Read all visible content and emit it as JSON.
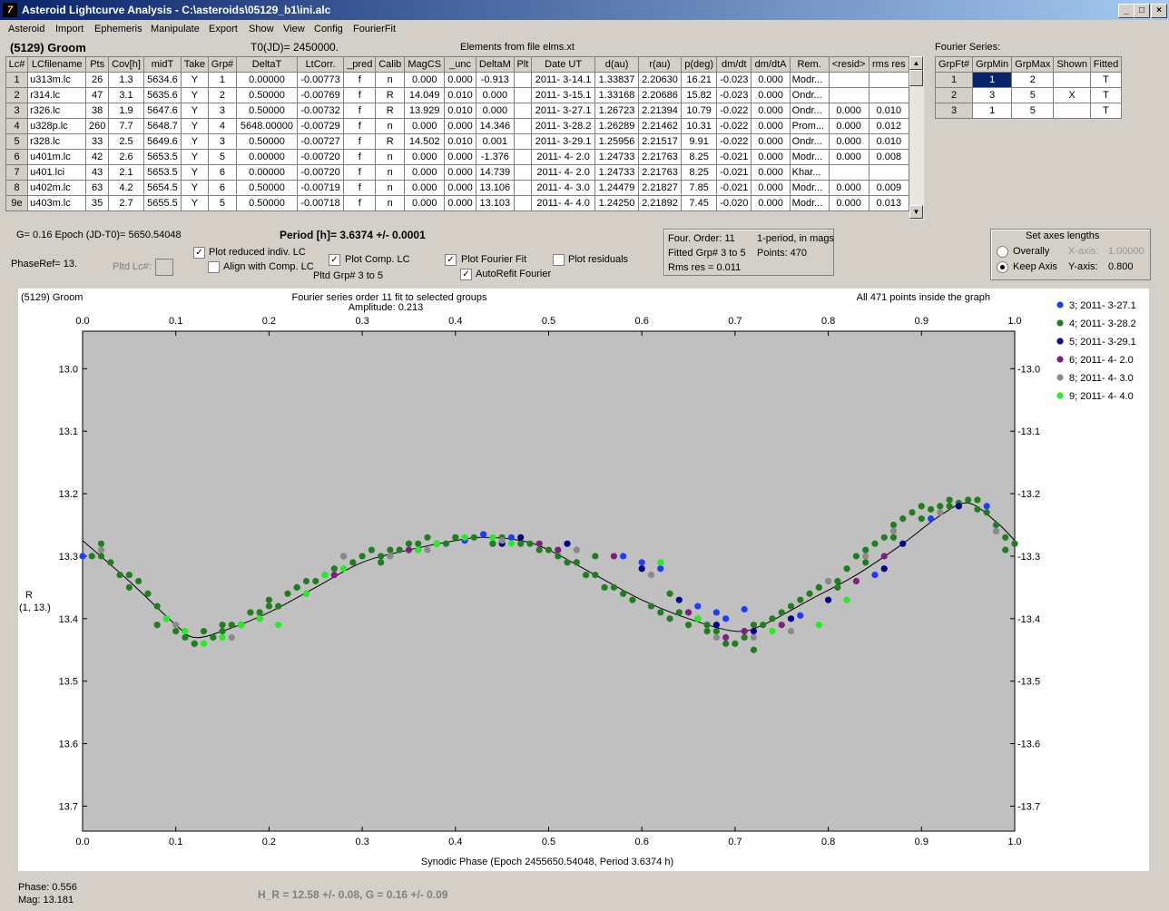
{
  "window": {
    "title": "Asteroid Lightcurve Analysis - C:\\asteroids\\05129_b1\\ini.alc",
    "min": "_",
    "max": "□",
    "close": "×"
  },
  "menu": [
    "Asteroid",
    "Import",
    "Ephemeris",
    "Manipulate",
    "Export",
    "Show",
    "View",
    "Config",
    "FourierFit"
  ],
  "header": {
    "object": "(5129) Groom",
    "t0": "T0(JD)= 2450000.",
    "elements": "Elements from file elms.xt",
    "fourier_series": "Fourier Series:"
  },
  "lc_table": {
    "columns": [
      "Lc#",
      "LCfilename",
      "Pts",
      "Cov[h]",
      "midT",
      "Take",
      "Grp#",
      "DeltaT",
      "LtCorr.",
      "_pred",
      "Calib",
      "MagCS",
      "_unc",
      "DeltaM",
      "Plt",
      "Date UT",
      "d(au)",
      "r(au)",
      "p(deg)",
      "dm/dt",
      "dm/dtA",
      "Rem.",
      "<resid>",
      "rms res"
    ],
    "rows": [
      [
        "1",
        "u313m.lc",
        "26",
        "1.3",
        "5634.6",
        "Y",
        "1",
        "0.00000",
        "-0.00773",
        "f",
        "n",
        "0.000",
        "0.000",
        "-0.913",
        "",
        "2011- 3-14.1",
        "1.33837",
        "2.20630",
        "16.21",
        "-0.023",
        "0.000",
        "Modr...",
        "",
        ""
      ],
      [
        "2",
        "r314.lc",
        "47",
        "3.1",
        "5635.6",
        "Y",
        "2",
        "0.50000",
        "-0.00769",
        "f",
        "R",
        "14.049",
        "0.010",
        "0.000",
        "",
        "2011- 3-15.1",
        "1.33168",
        "2.20686",
        "15.82",
        "-0.023",
        "0.000",
        "Ondr...",
        "",
        ""
      ],
      [
        "3",
        "r326.lc",
        "38",
        "1.9",
        "5647.6",
        "Y",
        "3",
        "0.50000",
        "-0.00732",
        "f",
        "R",
        "13.929",
        "0.010",
        "0.000",
        "",
        "2011- 3-27.1",
        "1.26723",
        "2.21394",
        "10.79",
        "-0.022",
        "0.000",
        "Ondr...",
        "0.000",
        "0.010"
      ],
      [
        "4",
        "u328p.lc",
        "260",
        "7.7",
        "5648.7",
        "Y",
        "4",
        "5648.00000",
        "-0.00729",
        "f",
        "n",
        "0.000",
        "0.000",
        "14.346",
        "",
        "2011- 3-28.2",
        "1.26289",
        "2.21462",
        "10.31",
        "-0.022",
        "0.000",
        "Prom...",
        "0.000",
        "0.012"
      ],
      [
        "5",
        "r328.lc",
        "33",
        "2.5",
        "5649.6",
        "Y",
        "3",
        "0.50000",
        "-0.00727",
        "f",
        "R",
        "14.502",
        "0.010",
        "0.001",
        "",
        "2011- 3-29.1",
        "1.25956",
        "2.21517",
        "9.91",
        "-0.022",
        "0.000",
        "Ondr...",
        "0.000",
        "0.010"
      ],
      [
        "6",
        "u401m.lc",
        "42",
        "2.6",
        "5653.5",
        "Y",
        "5",
        "0.00000",
        "-0.00720",
        "f",
        "n",
        "0.000",
        "0.000",
        "-1.376",
        "",
        "2011- 4- 2.0",
        "1.24733",
        "2.21763",
        "8.25",
        "-0.021",
        "0.000",
        "Modr...",
        "0.000",
        "0.008"
      ],
      [
        "7",
        "u401.lci",
        "43",
        "2.1",
        "5653.5",
        "Y",
        "6",
        "0.00000",
        "-0.00720",
        "f",
        "n",
        "0.000",
        "0.000",
        "14.739",
        "",
        "2011- 4- 2.0",
        "1.24733",
        "2.21763",
        "8.25",
        "-0.021",
        "0.000",
        "Khar...",
        "",
        ""
      ],
      [
        "8",
        "u402m.lc",
        "63",
        "4.2",
        "5654.5",
        "Y",
        "6",
        "0.50000",
        "-0.00719",
        "f",
        "n",
        "0.000",
        "0.000",
        "13.106",
        "",
        "2011- 4- 3.0",
        "1.24479",
        "2.21827",
        "7.85",
        "-0.021",
        "0.000",
        "Modr...",
        "0.000",
        "0.009"
      ],
      [
        "9e",
        "u403m.lc",
        "35",
        "2.7",
        "5655.5",
        "Y",
        "5",
        "0.50000",
        "-0.00718",
        "f",
        "n",
        "0.000",
        "0.000",
        "13.103",
        "",
        "2011- 4- 4.0",
        "1.24250",
        "2.21892",
        "7.45",
        "-0.020",
        "0.000",
        "Modr...",
        "0.000",
        "0.013"
      ]
    ]
  },
  "fourier_table": {
    "columns": [
      "GrpFt#",
      "GrpMin",
      "GrpMax",
      "Shown",
      "Fitted"
    ],
    "rows": [
      [
        "1",
        "1",
        "2",
        "",
        "T"
      ],
      [
        "2",
        "3",
        "5",
        "X",
        "T"
      ],
      [
        "3",
        "1",
        "5",
        "",
        "T"
      ]
    ]
  },
  "controls": {
    "g_epoch": "G= 0.16   Epoch (JD-T0)= 5650.54048",
    "period": "Period [h]= 3.6374 +/- 0.0001",
    "phase_ref": "PhaseRef= 13.",
    "pltd_lc": "Pltd Lc#:",
    "pltd_grp": "Pltd Grp#  3   to   5",
    "plot_reduced": "Plot reduced indiv. LC",
    "align_comp": "Align with Comp. LC",
    "plot_comp": "Plot Comp. LC",
    "plot_fourier": "Plot Fourier Fit",
    "autorefit": "AutoRefit Fourier",
    "plot_residuals": "Plot residuals",
    "four_order": "Four. Order: 11",
    "one_period": "1-period, in mags",
    "fitted_grp": "Fitted Grp# 3 to 5",
    "points": "Points: 470",
    "rms_res": "Rms res      = 0.011",
    "axes_title": "Set axes lengths",
    "overally": "Overally",
    "keep_axis": "Keep Axis",
    "x_axis_label": "X-axis:",
    "x_axis_value": "1.00000",
    "y_axis_label": "Y-axis:",
    "y_axis_value": "0.800"
  },
  "status": {
    "phase": "Phase:  0.556",
    "mag": "Mag:    13.181",
    "hg": "H_R = 12.58 +/- 0.08, G = 0.16 +/- 0.09"
  },
  "chart_data": {
    "type": "scatter",
    "title_left": "(5129) Groom",
    "title_center": "Fourier series order 11 fit to selected groups",
    "amplitude": "Amplitude: 0.213",
    "title_right": "All 471 points inside the graph",
    "xlabel": "Synodic Phase (Epoch 2455650.54048, Period 3.6374 h)",
    "ylabel": "R",
    "ylabel2": "(1, 13.)",
    "xlim": [
      0.0,
      1.0
    ],
    "ylim": [
      13.74,
      12.94
    ],
    "xticks": [
      "0.0",
      "0.1",
      "0.2",
      "0.3",
      "0.4",
      "0.5",
      "0.6",
      "0.7",
      "0.8",
      "0.9",
      "1.0"
    ],
    "yticks": [
      "13.0",
      "13.1",
      "13.2",
      "13.3",
      "13.4",
      "13.5",
      "13.6",
      "13.7"
    ],
    "fit_curve": [
      [
        0.0,
        13.275
      ],
      [
        0.05,
        13.34
      ],
      [
        0.1,
        13.41
      ],
      [
        0.12,
        13.43
      ],
      [
        0.15,
        13.42
      ],
      [
        0.2,
        13.39
      ],
      [
        0.25,
        13.35
      ],
      [
        0.3,
        13.31
      ],
      [
        0.35,
        13.29
      ],
      [
        0.4,
        13.275
      ],
      [
        0.43,
        13.27
      ],
      [
        0.47,
        13.275
      ],
      [
        0.5,
        13.29
      ],
      [
        0.55,
        13.33
      ],
      [
        0.6,
        13.37
      ],
      [
        0.65,
        13.4
      ],
      [
        0.7,
        13.42
      ],
      [
        0.73,
        13.41
      ],
      [
        0.78,
        13.37
      ],
      [
        0.83,
        13.33
      ],
      [
        0.88,
        13.28
      ],
      [
        0.92,
        13.235
      ],
      [
        0.95,
        13.215
      ],
      [
        0.98,
        13.245
      ],
      [
        1.0,
        13.275
      ]
    ],
    "series": [
      {
        "name": "3; 2011- 3-27.1",
        "color": "#1e3cff",
        "x": [
          0.41,
          0.43,
          0.44,
          0.46,
          0.58,
          0.6,
          0.62,
          0.66,
          0.68,
          0.69,
          0.71,
          0.77,
          0.79,
          0.85,
          0.91,
          0.97,
          0.0
        ],
        "y": [
          13.275,
          13.265,
          13.28,
          13.27,
          13.3,
          13.31,
          13.32,
          13.38,
          13.39,
          13.4,
          13.385,
          13.395,
          13.35,
          13.33,
          13.24,
          13.22,
          13.3
        ]
      },
      {
        "name": "4; 2011- 3-28.2",
        "color": "#1f7f1f",
        "x": [
          0.01,
          0.02,
          0.03,
          0.04,
          0.05,
          0.06,
          0.07,
          0.08,
          0.09,
          0.1,
          0.11,
          0.12,
          0.13,
          0.14,
          0.15,
          0.16,
          0.17,
          0.18,
          0.19,
          0.2,
          0.21,
          0.22,
          0.23,
          0.24,
          0.25,
          0.26,
          0.27,
          0.28,
          0.29,
          0.3,
          0.31,
          0.32,
          0.33,
          0.34,
          0.35,
          0.36,
          0.37,
          0.38,
          0.39,
          0.4,
          0.42,
          0.44,
          0.45,
          0.47,
          0.48,
          0.49,
          0.5,
          0.51,
          0.52,
          0.53,
          0.54,
          0.55,
          0.56,
          0.57,
          0.58,
          0.59,
          0.61,
          0.62,
          0.63,
          0.64,
          0.65,
          0.66,
          0.67,
          0.68,
          0.69,
          0.7,
          0.71,
          0.72,
          0.73,
          0.74,
          0.75,
          0.76,
          0.77,
          0.78,
          0.79,
          0.8,
          0.81,
          0.82,
          0.83,
          0.84,
          0.85,
          0.86,
          0.87,
          0.88,
          0.89,
          0.9,
          0.91,
          0.92,
          0.93,
          0.94,
          0.95,
          0.96,
          0.97,
          0.98,
          0.99,
          1.0,
          0.02,
          0.05,
          0.08,
          0.12,
          0.15,
          0.2,
          0.23,
          0.32,
          0.36,
          0.55,
          0.63,
          0.67,
          0.72,
          0.81,
          0.84,
          0.87,
          0.9,
          0.93,
          0.96,
          0.99
        ],
        "y": [
          13.3,
          13.3,
          13.31,
          13.33,
          13.35,
          13.34,
          13.36,
          13.38,
          13.4,
          13.42,
          13.43,
          13.44,
          13.42,
          13.43,
          13.42,
          13.41,
          13.41,
          13.39,
          13.39,
          13.37,
          13.38,
          13.36,
          13.35,
          13.34,
          13.34,
          13.33,
          13.32,
          13.3,
          13.31,
          13.3,
          13.29,
          13.3,
          13.29,
          13.29,
          13.28,
          13.28,
          13.27,
          13.28,
          13.28,
          13.27,
          13.27,
          13.28,
          13.27,
          13.28,
          13.28,
          13.29,
          13.29,
          13.3,
          13.31,
          13.31,
          13.33,
          13.33,
          13.35,
          13.35,
          13.36,
          13.37,
          13.38,
          13.39,
          13.4,
          13.39,
          13.41,
          13.4,
          13.42,
          13.42,
          13.44,
          13.44,
          13.43,
          13.41,
          13.41,
          13.4,
          13.39,
          13.38,
          13.37,
          13.36,
          13.35,
          13.34,
          13.34,
          13.32,
          13.3,
          13.29,
          13.28,
          13.27,
          13.25,
          13.24,
          13.23,
          13.22,
          13.225,
          13.22,
          13.22,
          13.215,
          13.21,
          13.225,
          13.23,
          13.25,
          13.27,
          13.28,
          13.28,
          13.33,
          13.41,
          13.44,
          13.41,
          13.38,
          13.35,
          13.31,
          13.29,
          13.3,
          13.36,
          13.41,
          13.45,
          13.35,
          13.31,
          13.27,
          13.24,
          13.21,
          13.21,
          13.29
        ]
      },
      {
        "name": "5; 2011- 3-29.1",
        "color": "#00008b",
        "x": [
          0.45,
          0.47,
          0.52,
          0.6,
          0.64,
          0.68,
          0.72,
          0.76,
          0.8,
          0.86,
          0.88,
          0.94
        ],
        "y": [
          13.28,
          13.27,
          13.28,
          13.32,
          13.37,
          13.41,
          13.42,
          13.4,
          13.37,
          13.32,
          13.28,
          13.22
        ]
      },
      {
        "name": "6; 2011- 4- 2.0",
        "color": "#7f1f7f",
        "x": [
          0.17,
          0.19,
          0.27,
          0.35,
          0.49,
          0.51,
          0.57,
          0.65,
          0.69,
          0.71,
          0.75,
          0.83,
          0.86
        ],
        "y": [
          13.41,
          13.4,
          13.33,
          13.29,
          13.28,
          13.29,
          13.3,
          13.39,
          13.43,
          13.42,
          13.41,
          13.34,
          13.3
        ]
      },
      {
        "name": "8; 2011- 4- 3.0",
        "color": "#8a8a8a",
        "x": [
          0.02,
          0.1,
          0.16,
          0.24,
          0.28,
          0.33,
          0.37,
          0.45,
          0.53,
          0.61,
          0.68,
          0.72,
          0.76,
          0.8,
          0.84,
          0.87,
          0.92,
          0.98
        ],
        "y": [
          13.29,
          13.41,
          13.43,
          13.36,
          13.3,
          13.3,
          13.29,
          13.275,
          13.29,
          13.33,
          13.43,
          13.43,
          13.42,
          13.34,
          13.3,
          13.26,
          13.23,
          13.26
        ]
      },
      {
        "name": "9; 2011- 4- 4.0",
        "color": "#22ee22",
        "x": [
          0.09,
          0.11,
          0.13,
          0.15,
          0.17,
          0.19,
          0.21,
          0.24,
          0.26,
          0.28,
          0.36,
          0.38,
          0.41,
          0.44,
          0.46,
          0.62,
          0.66,
          0.74,
          0.79,
          0.82
        ],
        "y": [
          13.4,
          13.42,
          13.44,
          13.43,
          13.41,
          13.4,
          13.41,
          13.36,
          13.33,
          13.32,
          13.29,
          13.28,
          13.27,
          13.27,
          13.28,
          13.31,
          13.4,
          13.42,
          13.41,
          13.37
        ]
      }
    ]
  }
}
